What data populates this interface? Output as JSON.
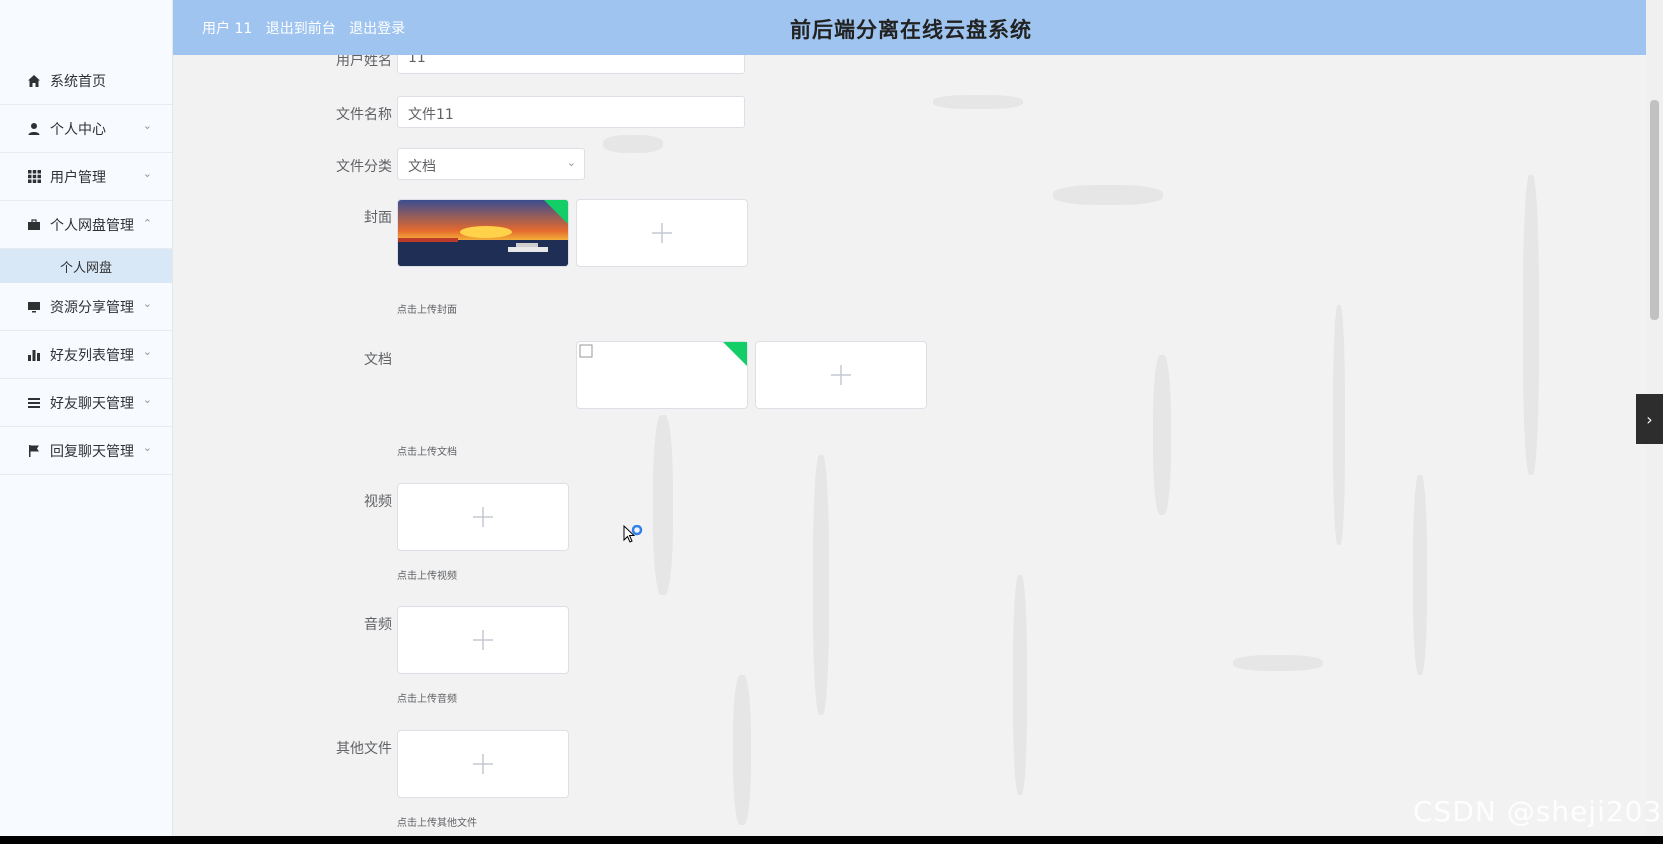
{
  "app": {
    "title": "前后端分离在线云盘系统"
  },
  "header": {
    "user_label": "用户 11",
    "back_front_label": "退出到前台",
    "logout_label": "退出登录"
  },
  "sidebar": {
    "items": [
      {
        "label": "系统首页",
        "icon": "home-icon"
      },
      {
        "label": "个人中心",
        "icon": "user-icon"
      },
      {
        "label": "用户管理",
        "icon": "grid-icon"
      },
      {
        "label": "个人网盘管理",
        "icon": "briefcase-icon"
      },
      {
        "label": "资源分享管理",
        "icon": "monitor-icon"
      },
      {
        "label": "好友列表管理",
        "icon": "bar-chart-icon"
      },
      {
        "label": "好友聊天管理",
        "icon": "list-icon"
      },
      {
        "label": "回复聊天管理",
        "icon": "flag-icon"
      }
    ],
    "sub_items": [
      {
        "label": "个人网盘"
      }
    ]
  },
  "form": {
    "username_label": "用户姓名",
    "username_value": "11",
    "filename_label": "文件名称",
    "filename_value": "文件11",
    "category_label": "文件分类",
    "category_value": "文档",
    "cover_label": "封面",
    "cover_hint": "点击上传封面",
    "doc_label": "文档",
    "doc_hint": "点击上传文档",
    "video_label": "视频",
    "video_hint": "点击上传视频",
    "audio_label": "音频",
    "audio_hint": "点击上传音频",
    "other_label": "其他文件",
    "other_hint": "点击上传其他文件"
  },
  "watermark": "CSDN @sheji203",
  "colors": {
    "header_bg": "#9ec4ef",
    "sidebar_active_bg": "#d9e8f7",
    "upload_success": "#13ce66",
    "page_bg": "#f2f2f2"
  }
}
